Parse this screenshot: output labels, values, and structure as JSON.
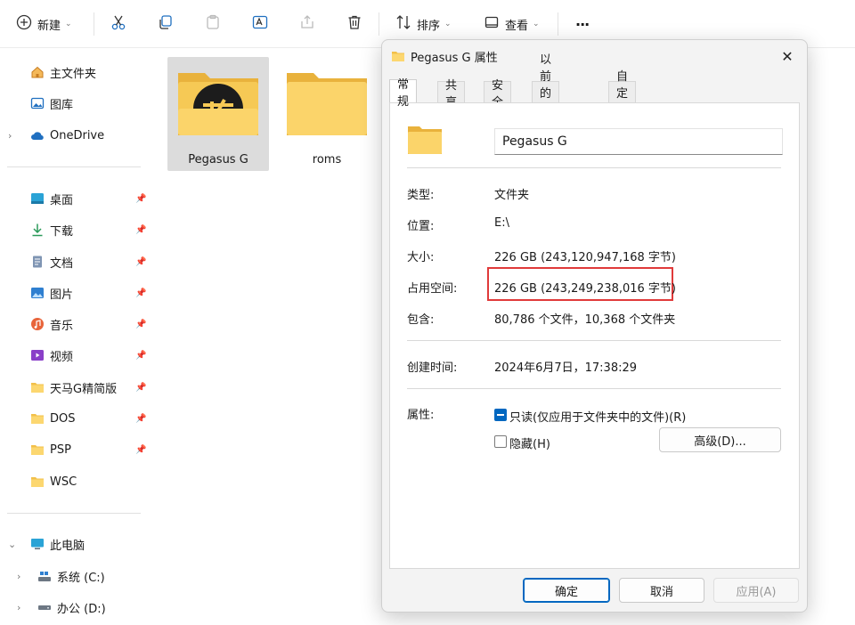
{
  "toolbar": {
    "new_label": "新建",
    "sort_label": "排序",
    "view_label": "查看",
    "more_label": "···"
  },
  "nav": {
    "home": "主文件夹",
    "gallery": "图库",
    "onedrive": "OneDrive",
    "quick": [
      {
        "label": "桌面"
      },
      {
        "label": "下载"
      },
      {
        "label": "文档"
      },
      {
        "label": "图片"
      },
      {
        "label": "音乐"
      },
      {
        "label": "视频"
      },
      {
        "label": "天马G精简版"
      },
      {
        "label": "DOS"
      },
      {
        "label": "PSP"
      },
      {
        "label": "WSC"
      }
    ],
    "thispc": "此电脑",
    "drives": [
      {
        "label": "系统 (C:)"
      },
      {
        "label": "办公 (D:)"
      }
    ]
  },
  "content": {
    "items": [
      {
        "label": "Pegasus G"
      },
      {
        "label": "roms"
      }
    ]
  },
  "dialog": {
    "title": "Pegasus G 属性",
    "tabs": [
      {
        "label": "常规"
      },
      {
        "label": "共享"
      },
      {
        "label": "安全"
      },
      {
        "label": "以前的版本"
      },
      {
        "label": "自定义"
      }
    ],
    "name_value": "Pegasus G",
    "type_label": "类型:",
    "type_value": "文件夹",
    "location_label": "位置:",
    "location_value": "E:\\",
    "size_label": "大小:",
    "size_value": "226 GB (243,120,947,168 字节)",
    "disk_label": "占用空间:",
    "disk_value": "226 GB (243,249,238,016 字节)",
    "contains_label": "包含:",
    "contains_value": "80,786 个文件，10,368 个文件夹",
    "created_label": "创建时间:",
    "created_value": "2024年6月7日，17:38:29",
    "attr_label": "属性:",
    "readonly_label": "只读(仅应用于文件夹中的文件)(R)",
    "hidden_label": "隐藏(H)",
    "advanced_label": "高级(D)...",
    "ok_label": "确定",
    "cancel_label": "取消",
    "apply_label": "应用(A)"
  }
}
